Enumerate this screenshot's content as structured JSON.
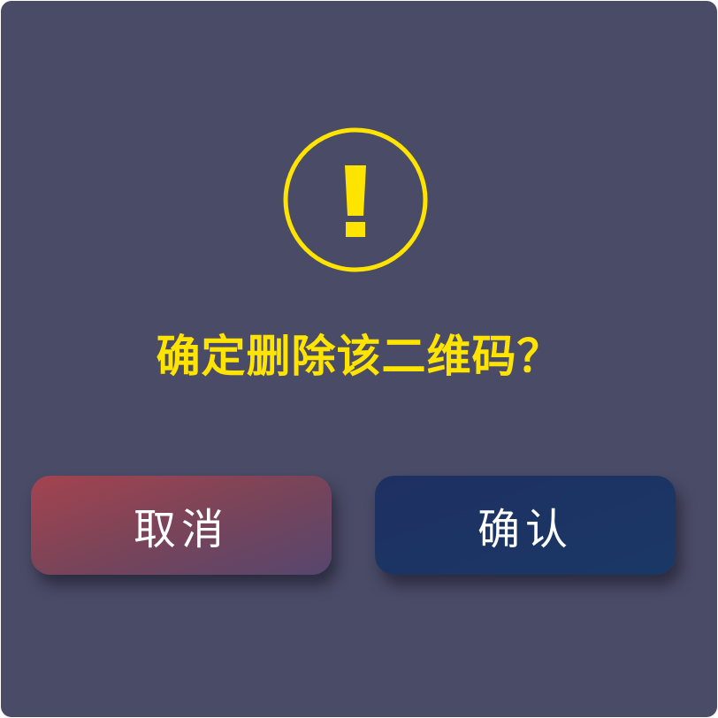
{
  "dialog": {
    "icon": "exclamation-circle-icon",
    "title": "确定删除该二维码？",
    "cancel_label": "取消",
    "confirm_label": "确认"
  },
  "colors": {
    "background": "#4a4b67",
    "accent": "#ffe400",
    "cancel_button": "#a4434f",
    "confirm_button": "#1e3062",
    "button_text": "#ffffff"
  }
}
